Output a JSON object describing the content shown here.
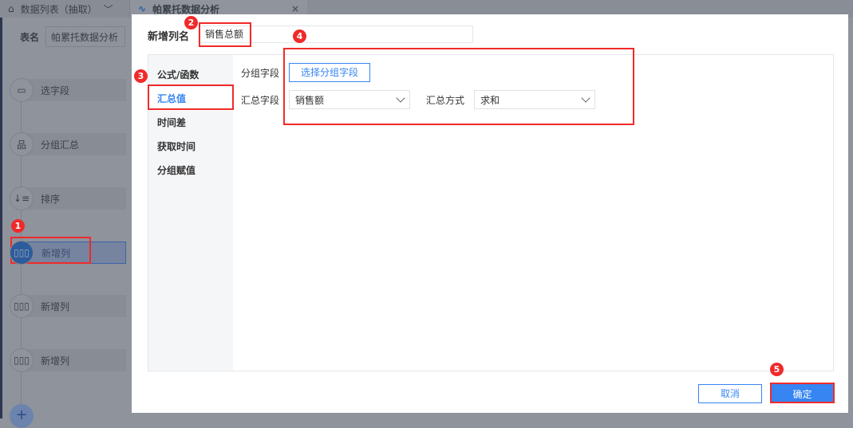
{
  "tabs": [
    {
      "label": "数据列表（抽取）",
      "icon": "home-icon"
    },
    {
      "label": "帕累托数据分析",
      "icon": "chart-line-icon",
      "close": "×"
    }
  ],
  "table_name": {
    "label": "表名",
    "value": "帕累托数据分析"
  },
  "flow_nodes": [
    {
      "label": "选字段",
      "icon": "select-field-icon"
    },
    {
      "label": "分组汇总",
      "icon": "group-icon"
    },
    {
      "label": "排序",
      "icon": "sort-icon"
    },
    {
      "label": "新增列",
      "icon": "add-column-icon",
      "active": true
    },
    {
      "label": "新增列",
      "icon": "add-column-icon"
    },
    {
      "label": "新增列",
      "icon": "add-column-icon"
    }
  ],
  "add_step": "+",
  "dialog": {
    "title": "新增列名",
    "column_name": "销售总额",
    "menu": [
      "公式/函数",
      "汇总值",
      "时间差",
      "获取时间",
      "分组赋值"
    ],
    "selected_menu": 1,
    "group_label": "分组字段",
    "group_button": "选择分组字段",
    "sum_field_label": "汇总字段",
    "sum_field_value": "销售额",
    "sum_method_label": "汇总方式",
    "sum_method_value": "求和",
    "cancel": "取消",
    "confirm": "确定"
  },
  "badges": [
    "1",
    "2",
    "3",
    "4",
    "5"
  ],
  "colors": {
    "accent": "#3685f2",
    "highlight": "#f02a2a"
  }
}
